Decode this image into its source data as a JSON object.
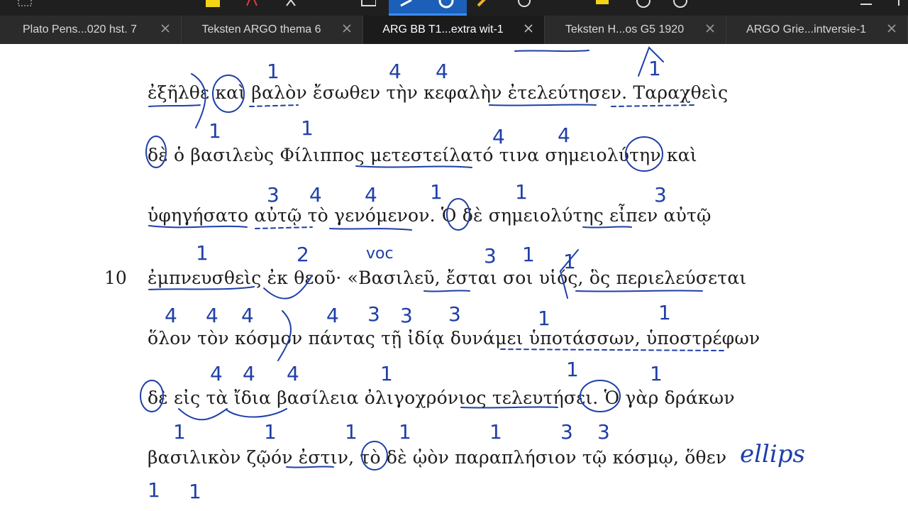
{
  "tabs": [
    {
      "label": "Plato Pens...020 hst. 7",
      "active": false
    },
    {
      "label": "Teksten ARGO thema 6",
      "active": false
    },
    {
      "label": "ARG BB T1...extra wit-1",
      "active": true
    },
    {
      "label": "Teksten H...os G5 1920",
      "active": false
    },
    {
      "label": "ARGO Grie...intversie-1",
      "active": false
    }
  ],
  "toolbar_icons": [
    "grid-icon",
    "highlighter-icon",
    "text-color-icon",
    "lasso-icon",
    "shape-icon",
    "pen-icon",
    "circle-tool-icon",
    "marker-icon",
    "eraser-icon",
    "comment-icon",
    "zoom-icon",
    "timer-icon",
    "export-icon",
    "more-icon"
  ],
  "document": {
    "lines": [
      "ἐξῆλθε καὶ βαλὸν ἔσωθεν τὴν κεφαλὴν ἐτελεύτησεν. Ταραχθεὶς",
      "δὲ ὁ βασιλεὺς Φίλιππος μετεστείλατό τινα σημειολύτην καὶ",
      "ὑφηγήσατο αὐτῷ τὸ γενόμενον. Ὁ δὲ σημειολύτης εἶπεν αὐτῷ",
      "ἐμπνευσθεὶς ἐκ θεοῦ· «Βασιλεῦ, ἔσται σοι υἱός, ὃς περιελεύσεται",
      "ὅλον τὸν κόσμον πάντας τῇ ἰδίᾳ δυνάμει ὑποτάσσων, ὑποστρέφων",
      "δὲ εἰς τὰ ἴδια βασίλεια ὀλιγοχρόνιος τελευτήσει. Ὁ γὰρ δράκων",
      "βασιλικὸν ζῷόν ἐστιν, τὸ δὲ ᾠὸν παραπλήσιον τῷ κόσμῳ, ὅθεν"
    ],
    "line_number": "10"
  },
  "annotations": {
    "line1": [
      "1",
      "4",
      "4",
      "1"
    ],
    "line2": [
      "1",
      "1",
      "4",
      "4"
    ],
    "line3": [
      "3",
      "4",
      "4",
      "1",
      "1",
      "3"
    ],
    "line4": [
      "1",
      "2",
      "voc",
      "3",
      "1",
      "1"
    ],
    "line5": [
      "4",
      "4",
      "4",
      "4",
      "3",
      "3",
      "3",
      "1",
      "1"
    ],
    "line6": [
      "4",
      "4",
      "4",
      "1",
      "1",
      "1"
    ],
    "line7": [
      "1",
      "1",
      "1",
      "1",
      "1",
      "3",
      "3"
    ],
    "line8": [
      "1",
      "1"
    ],
    "margin_note": "ellips"
  },
  "colors": {
    "ink": "#1f3fa8",
    "tab_bg": "#2b2b2b",
    "active_tab": "#1b1b1b",
    "toolbar_accent": "#1c5fb8"
  }
}
